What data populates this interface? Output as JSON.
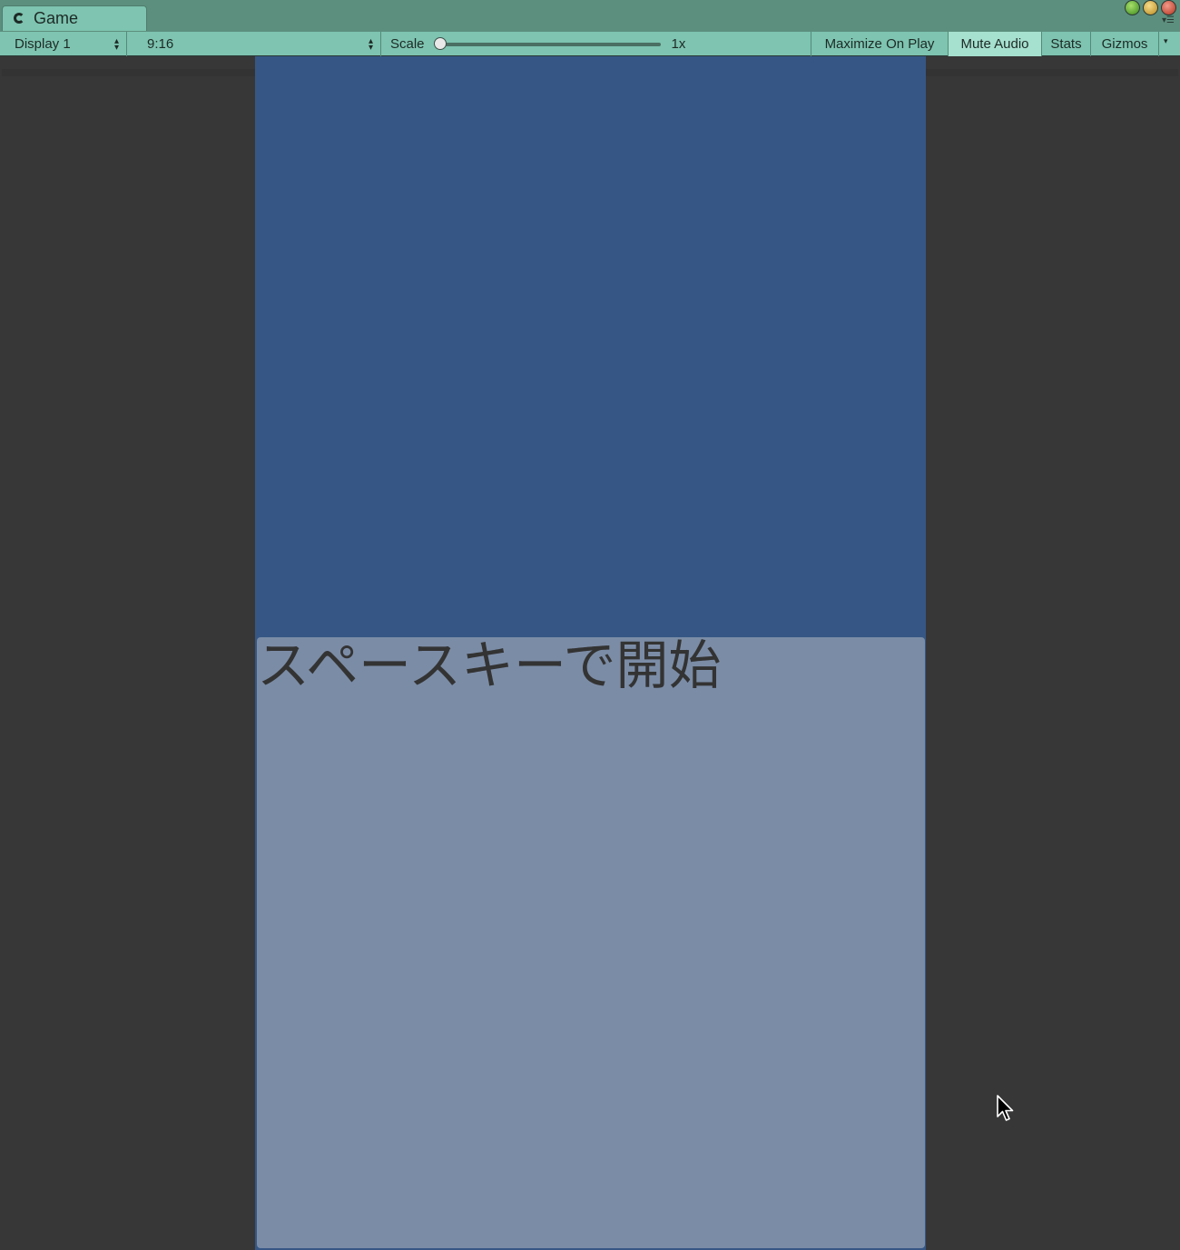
{
  "window": {
    "tab_title": "Game"
  },
  "toolbar": {
    "display_select": "Display 1",
    "aspect_select": "9:16",
    "scale_label": "Scale",
    "scale_value": "1x",
    "scale_fraction": 0,
    "maximize_on_play": "Maximize On Play",
    "mute_audio": "Mute Audio",
    "stats": "Stats",
    "gizmos": "Gizmos"
  },
  "game_view": {
    "background_color": "#365785",
    "panel_color": "#7b8ca6",
    "panel_text": "スペースキーで開始"
  }
}
